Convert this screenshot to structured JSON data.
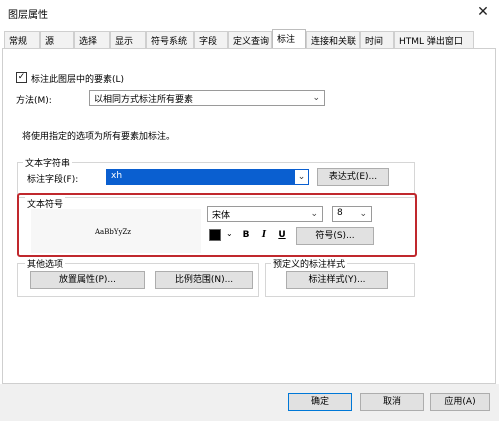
{
  "window": {
    "title": "图层属性",
    "close_glyph": "✕"
  },
  "tabs": [
    {
      "label": "常规"
    },
    {
      "label": "源"
    },
    {
      "label": "选择"
    },
    {
      "label": "显示"
    },
    {
      "label": "符号系统"
    },
    {
      "label": "字段"
    },
    {
      "label": "定义查询"
    },
    {
      "label": "标注"
    },
    {
      "label": "连接和关联"
    },
    {
      "label": "时间"
    },
    {
      "label": "HTML 弹出窗口"
    }
  ],
  "active_tab": "标注",
  "label_features_checkbox": {
    "label": "标注此图层中的要素(L)",
    "checked": true,
    "glyph": "✓"
  },
  "method": {
    "label": "方法(M):",
    "value": "以相同方式标注所有要素"
  },
  "info_text": "将使用指定的选项为所有要素加标注。",
  "text_string_group": {
    "title": "文本字符串",
    "field_label": "标注字段(F):",
    "field_value": "xh",
    "expression_button": "表达式(E)..."
  },
  "text_symbol_group": {
    "title": "文本符号",
    "preview_text": "AaBbYyZz",
    "font_value": "宋体",
    "size_value": "8",
    "bold": "B",
    "italic": "I",
    "underline": "U",
    "symbol_button": "符号(S)...",
    "color_swatch": "#000000",
    "highlight_color": "#c0282d"
  },
  "other_options_group": {
    "title": "其他选项",
    "placement_button": "放置属性(P)...",
    "scale_range_button": "比例范围(N)..."
  },
  "predefined_styles_group": {
    "title": "预定义的标注样式",
    "label_styles_button": "标注样式(Y)..."
  },
  "footer": {
    "ok": "确定",
    "cancel": "取消",
    "apply": "应用(A)"
  },
  "arrow_glyph": "⌄"
}
